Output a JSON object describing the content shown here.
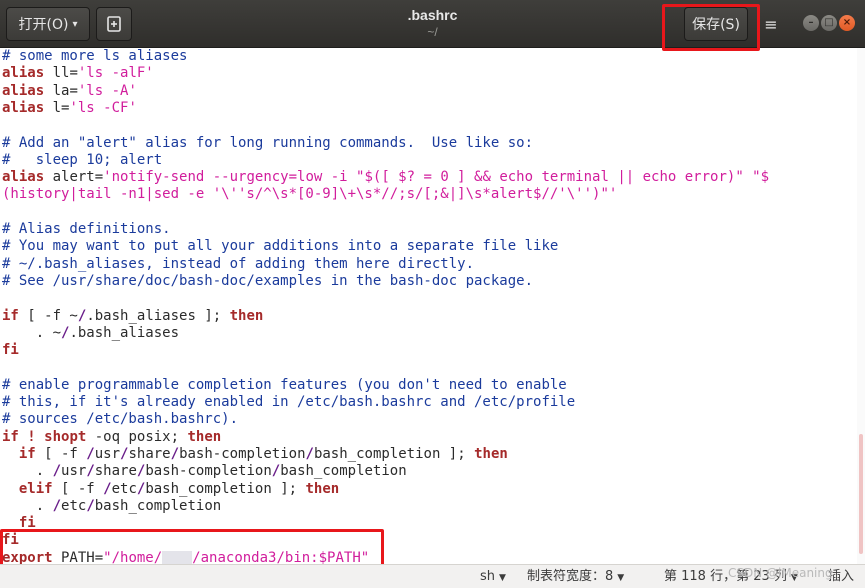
{
  "header": {
    "open_label": "打开(O)",
    "open_caret": "▾",
    "new_icon": "new-document-icon",
    "title": ".bashrc",
    "subtitle": "~/",
    "save_label": "保存(S)",
    "menu_icon": "≡",
    "window_controls": {
      "minimize": "–",
      "maximize": "□",
      "close": "×"
    }
  },
  "editor": {
    "lines": [
      [
        {
          "t": "# some more ls aliases",
          "c": "c"
        }
      ],
      [
        {
          "t": "alias",
          "c": "k"
        },
        {
          "t": " ll=",
          "c": ""
        },
        {
          "t": "'ls -alF'",
          "c": "s"
        }
      ],
      [
        {
          "t": "alias",
          "c": "k"
        },
        {
          "t": " la=",
          "c": ""
        },
        {
          "t": "'ls -A'",
          "c": "s"
        }
      ],
      [
        {
          "t": "alias",
          "c": "k"
        },
        {
          "t": " l=",
          "c": ""
        },
        {
          "t": "'ls -CF'",
          "c": "s"
        }
      ],
      [],
      [
        {
          "t": "# Add an \"alert\" alias for long running commands.  Use like so:",
          "c": "c"
        }
      ],
      [
        {
          "t": "#   sleep 10; alert",
          "c": "c"
        }
      ],
      [
        {
          "t": "alias",
          "c": "k"
        },
        {
          "t": " alert=",
          "c": ""
        },
        {
          "t": "'notify-send --urgency=low -i \"$([ $? = 0 ] && echo terminal || echo error)\" \"$",
          "c": "s"
        }
      ],
      [
        {
          "t": "(history|tail -n1|sed -e '\\''s/^\\s*[0-9]\\+\\s*//;s/[;&|]\\s*alert$//'\\'')\"'",
          "c": "s"
        }
      ],
      [],
      [
        {
          "t": "# Alias definitions.",
          "c": "c"
        }
      ],
      [
        {
          "t": "# You may want to put all your additions into a separate file like",
          "c": "c"
        }
      ],
      [
        {
          "t": "# ~/.bash_aliases, instead of adding them here directly.",
          "c": "c"
        }
      ],
      [
        {
          "t": "# See /usr/share/doc/bash-doc/examples in the bash-doc package.",
          "c": "c"
        }
      ],
      [],
      [
        {
          "t": "if",
          "c": "k"
        },
        {
          "t": " [ -f ~",
          "c": ""
        },
        {
          "t": "/",
          "c": "p"
        },
        {
          "t": ".bash_aliases ]; ",
          "c": ""
        },
        {
          "t": "then",
          "c": "k"
        }
      ],
      [
        {
          "t": "    . ~",
          "c": ""
        },
        {
          "t": "/",
          "c": "p"
        },
        {
          "t": ".bash_aliases",
          "c": ""
        }
      ],
      [
        {
          "t": "fi",
          "c": "k"
        }
      ],
      [],
      [
        {
          "t": "# enable programmable completion features (you don't need to enable",
          "c": "c"
        }
      ],
      [
        {
          "t": "# this, if it's already enabled in /etc/bash.bashrc and /etc/profile",
          "c": "c"
        }
      ],
      [
        {
          "t": "# sources /etc/bash.bashrc).",
          "c": "c"
        }
      ],
      [
        {
          "t": "if",
          "c": "k"
        },
        {
          "t": " ",
          "c": ""
        },
        {
          "t": "!",
          "c": "k"
        },
        {
          "t": " ",
          "c": ""
        },
        {
          "t": "shopt",
          "c": "k"
        },
        {
          "t": " -oq posix; ",
          "c": ""
        },
        {
          "t": "then",
          "c": "k"
        }
      ],
      [
        {
          "t": "  ",
          "c": ""
        },
        {
          "t": "if",
          "c": "k"
        },
        {
          "t": " [ -f ",
          "c": ""
        },
        {
          "t": "/",
          "c": "p"
        },
        {
          "t": "usr",
          "c": ""
        },
        {
          "t": "/",
          "c": "p"
        },
        {
          "t": "share",
          "c": ""
        },
        {
          "t": "/",
          "c": "p"
        },
        {
          "t": "bash-completion",
          "c": ""
        },
        {
          "t": "/",
          "c": "p"
        },
        {
          "t": "bash_completion ]; ",
          "c": ""
        },
        {
          "t": "then",
          "c": "k"
        }
      ],
      [
        {
          "t": "    . ",
          "c": ""
        },
        {
          "t": "/",
          "c": "p"
        },
        {
          "t": "usr",
          "c": ""
        },
        {
          "t": "/",
          "c": "p"
        },
        {
          "t": "share",
          "c": ""
        },
        {
          "t": "/",
          "c": "p"
        },
        {
          "t": "bash-completion",
          "c": ""
        },
        {
          "t": "/",
          "c": "p"
        },
        {
          "t": "bash_completion",
          "c": ""
        }
      ],
      [
        {
          "t": "  ",
          "c": ""
        },
        {
          "t": "elif",
          "c": "k"
        },
        {
          "t": " [ -f ",
          "c": ""
        },
        {
          "t": "/",
          "c": "p"
        },
        {
          "t": "etc",
          "c": ""
        },
        {
          "t": "/",
          "c": "p"
        },
        {
          "t": "bash_completion ]; ",
          "c": ""
        },
        {
          "t": "then",
          "c": "k"
        }
      ],
      [
        {
          "t": "    . ",
          "c": ""
        },
        {
          "t": "/",
          "c": "p"
        },
        {
          "t": "etc",
          "c": ""
        },
        {
          "t": "/",
          "c": "p"
        },
        {
          "t": "bash_completion",
          "c": ""
        }
      ],
      [
        {
          "t": "  ",
          "c": ""
        },
        {
          "t": "fi",
          "c": "k"
        }
      ],
      [
        {
          "t": "fi",
          "c": "k"
        }
      ],
      [
        {
          "t": "export",
          "c": "k"
        },
        {
          "t": " PATH=",
          "c": ""
        },
        {
          "t": "\"/home/",
          "c": "s"
        },
        {
          "t": "",
          "c": "redact"
        },
        {
          "t": "/anaconda3/bin:$PATH\"",
          "c": "s"
        }
      ]
    ]
  },
  "statusbar": {
    "language": "sh",
    "tab_width": "制表符宽度：8",
    "position": "第 118 行，第 23 列",
    "insert_mode": "插入",
    "watermark": "CSDN @iMeaning"
  },
  "colors": {
    "keyword": "#a52a2a",
    "string": "#d11d9c",
    "comment": "#1b3b9c",
    "highlight": "#e8171b",
    "header_bg": "#3a3936"
  }
}
